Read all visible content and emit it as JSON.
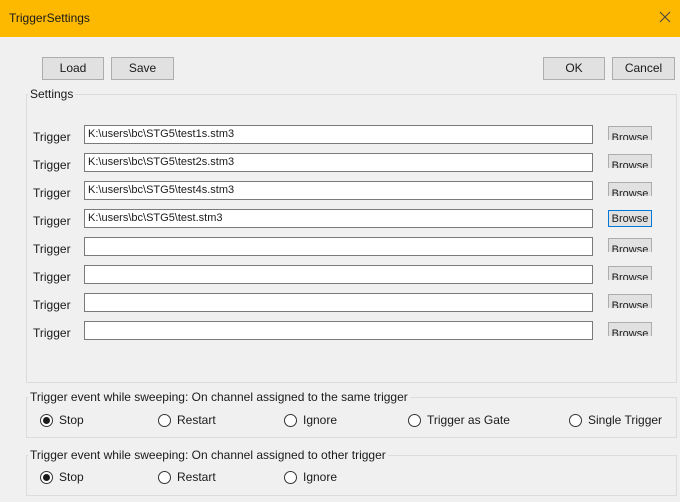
{
  "window": {
    "title": "TriggerSettings"
  },
  "toolbar": {
    "load": "Load",
    "save": "Save",
    "ok": "OK",
    "cancel": "Cancel"
  },
  "settings": {
    "legend": "Settings",
    "rows": [
      {
        "label": "Trigger",
        "value": "K:\\users\\bc\\STG5\\test1s.stm3",
        "browse": "Browse"
      },
      {
        "label": "Trigger",
        "value": "K:\\users\\bc\\STG5\\test2s.stm3",
        "browse": "Browse"
      },
      {
        "label": "Trigger",
        "value": "K:\\users\\bc\\STG5\\test4s.stm3",
        "browse": "Browse"
      },
      {
        "label": "Trigger",
        "value": "K:\\users\\bc\\STG5\\test.stm3",
        "browse": "Browse"
      },
      {
        "label": "Trigger",
        "value": "",
        "browse": "Browse"
      },
      {
        "label": "Trigger",
        "value": "",
        "browse": "Browse"
      },
      {
        "label": "Trigger",
        "value": "",
        "browse": "Browse"
      },
      {
        "label": "Trigger",
        "value": "",
        "browse": "Browse"
      }
    ]
  },
  "same_trigger": {
    "legend": "Trigger event while sweeping: On channel assigned to the same trigger",
    "options": [
      "Stop",
      "Restart",
      "Ignore",
      "Trigger as Gate",
      "Single Trigger"
    ],
    "selected": "Stop"
  },
  "other_trigger": {
    "legend": "Trigger event while sweeping: On channel assigned to other trigger",
    "options": [
      "Stop",
      "Restart",
      "Ignore"
    ],
    "selected": "Stop"
  }
}
